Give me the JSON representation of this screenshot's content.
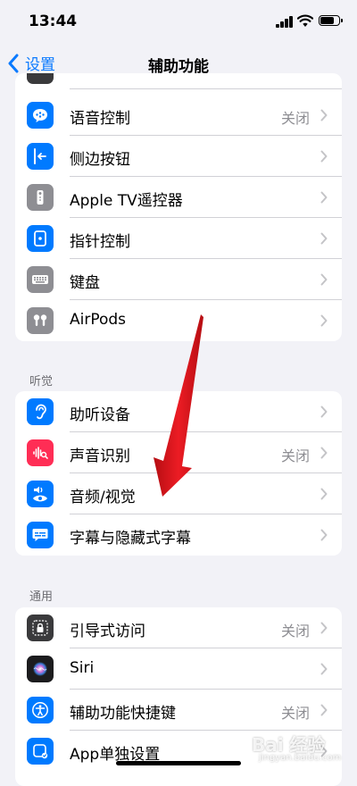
{
  "status_bar": {
    "time": "13:44"
  },
  "nav": {
    "back_label": "设置",
    "title": "辅助功能"
  },
  "sections": {
    "interaction": {
      "items": [
        {
          "label": "语音控制",
          "value": "关闭",
          "icon": "voice-control-icon",
          "color": "#007aff"
        },
        {
          "label": "侧边按钮",
          "value": "",
          "icon": "side-button-icon",
          "color": "#007aff"
        },
        {
          "label": "Apple TV遥控器",
          "value": "",
          "icon": "remote-icon",
          "color": "#8e8e93"
        },
        {
          "label": "指针控制",
          "value": "",
          "icon": "pointer-control-icon",
          "color": "#007aff"
        },
        {
          "label": "键盘",
          "value": "",
          "icon": "keyboard-icon",
          "color": "#8e8e93"
        },
        {
          "label": "AirPods",
          "value": "",
          "icon": "airpods-icon",
          "color": "#8e8e93"
        }
      ]
    },
    "hearing": {
      "header": "听觉",
      "items": [
        {
          "label": "助听设备",
          "value": "",
          "icon": "ear-icon",
          "color": "#007aff"
        },
        {
          "label": "声音识别",
          "value": "关闭",
          "icon": "sound-recognition-icon",
          "color": "#ff2d55"
        },
        {
          "label": "音频/视觉",
          "value": "",
          "icon": "audio-visual-icon",
          "color": "#007aff"
        },
        {
          "label": "字幕与隐藏式字幕",
          "value": "",
          "icon": "captions-icon",
          "color": "#007aff"
        }
      ]
    },
    "general": {
      "header": "通用",
      "items": [
        {
          "label": "引导式访问",
          "value": "关闭",
          "icon": "guided-access-icon",
          "color": "#3a3a3c"
        },
        {
          "label": "Siri",
          "value": "",
          "icon": "siri-icon",
          "color": "#1c1c1e"
        },
        {
          "label": "辅助功能快捷键",
          "value": "关闭",
          "icon": "accessibility-shortcut-icon",
          "color": "#007aff"
        },
        {
          "label": "App单独设置",
          "value": "",
          "icon": "per-app-settings-icon",
          "color": "#007aff"
        }
      ]
    }
  },
  "watermark": {
    "text": "Bai 经验",
    "sub": "jingyan.baidu.com"
  },
  "colors": {
    "accent": "#0a7aff",
    "annotation_arrow": "#e3141b"
  }
}
